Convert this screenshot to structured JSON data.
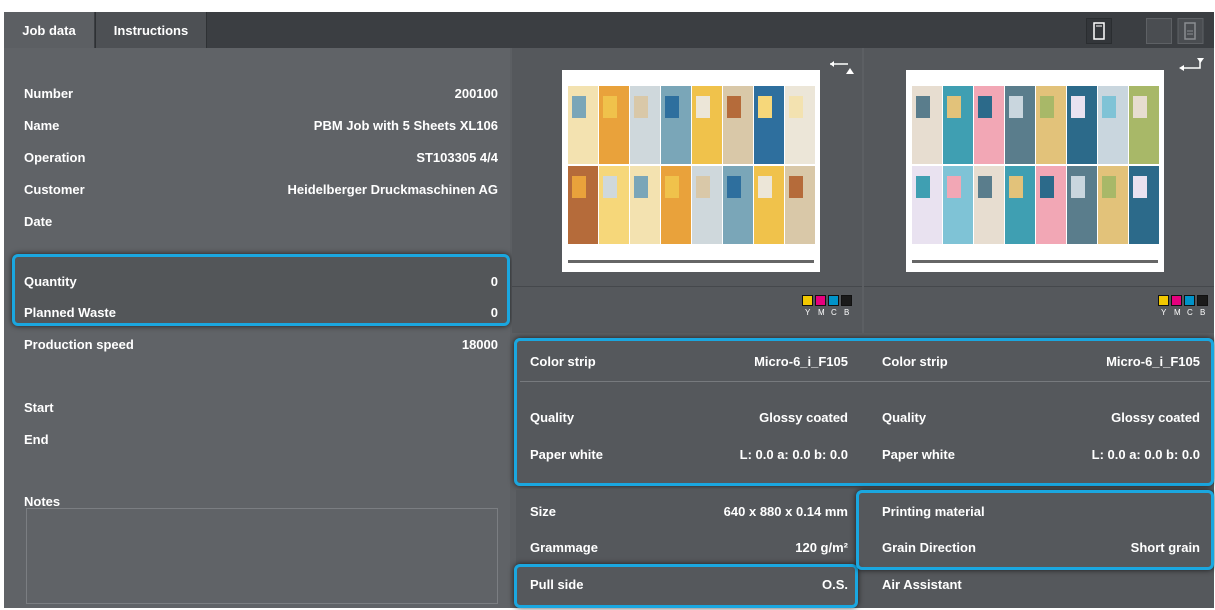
{
  "tabs": [
    {
      "label": "Job data",
      "active": true
    },
    {
      "label": "Instructions",
      "active": false
    }
  ],
  "job": {
    "rows": [
      {
        "label": "Number",
        "value": "200100"
      },
      {
        "label": "Name",
        "value": "PBM Job with 5 Sheets XL106"
      },
      {
        "label": "Operation",
        "value": "ST103305  4/4"
      },
      {
        "label": "Customer",
        "value": "Heidelberger Druckmaschinen AG"
      },
      {
        "label": "Date",
        "value": ""
      }
    ],
    "quantity": {
      "label": "Quantity",
      "value": "0"
    },
    "planned_waste": {
      "label": "Planned Waste",
      "value": "0"
    },
    "production_speed": {
      "label": "Production speed",
      "value": "18000"
    },
    "start": {
      "label": "Start",
      "value": ""
    },
    "end": {
      "label": "End",
      "value": ""
    },
    "notes_label": "Notes"
  },
  "colors": {
    "accent": "#1aa7e0",
    "panel": "#5c5f63",
    "dark": "#3b3e42"
  },
  "swatches": [
    {
      "letter": "Y",
      "color": "#f2c800"
    },
    {
      "letter": "M",
      "color": "#e6007e"
    },
    {
      "letter": "C",
      "color": "#0093c9"
    },
    {
      "letter": "B",
      "color": "#1a1a1a"
    }
  ],
  "front": {
    "color_strip": {
      "label": "Color strip",
      "value": "Micro-6_i_F105"
    },
    "quality": {
      "label": "Quality",
      "value": "Glossy coated"
    },
    "paper_white": {
      "label": "Paper white",
      "value": "L: 0.0 a: 0.0 b: 0.0"
    }
  },
  "back": {
    "color_strip": {
      "label": "Color strip",
      "value": "Micro-6_i_F105"
    },
    "quality": {
      "label": "Quality",
      "value": "Glossy coated"
    },
    "paper_white": {
      "label": "Paper white",
      "value": "L: 0.0 a: 0.0 b: 0.0"
    }
  },
  "material": {
    "size": {
      "label": "Size",
      "value": "640 x 880 x 0.14 mm"
    },
    "grammage": {
      "label": "Grammage",
      "value": "120 g/m²"
    },
    "pull_side": {
      "label": "Pull side",
      "value": "O.S."
    },
    "printing_material": {
      "label": "Printing material",
      "value": ""
    },
    "grain_direction": {
      "label": "Grain Direction",
      "value": "Short grain"
    },
    "air_assistant": {
      "label": "Air Assistant",
      "value": ""
    }
  },
  "icons": {
    "front_turn": "turn-arrow-up-icon",
    "back_turn": "turn-arrow-down-icon",
    "single_view": "single-sheet-icon",
    "double_view": "double-sheet-icon"
  }
}
